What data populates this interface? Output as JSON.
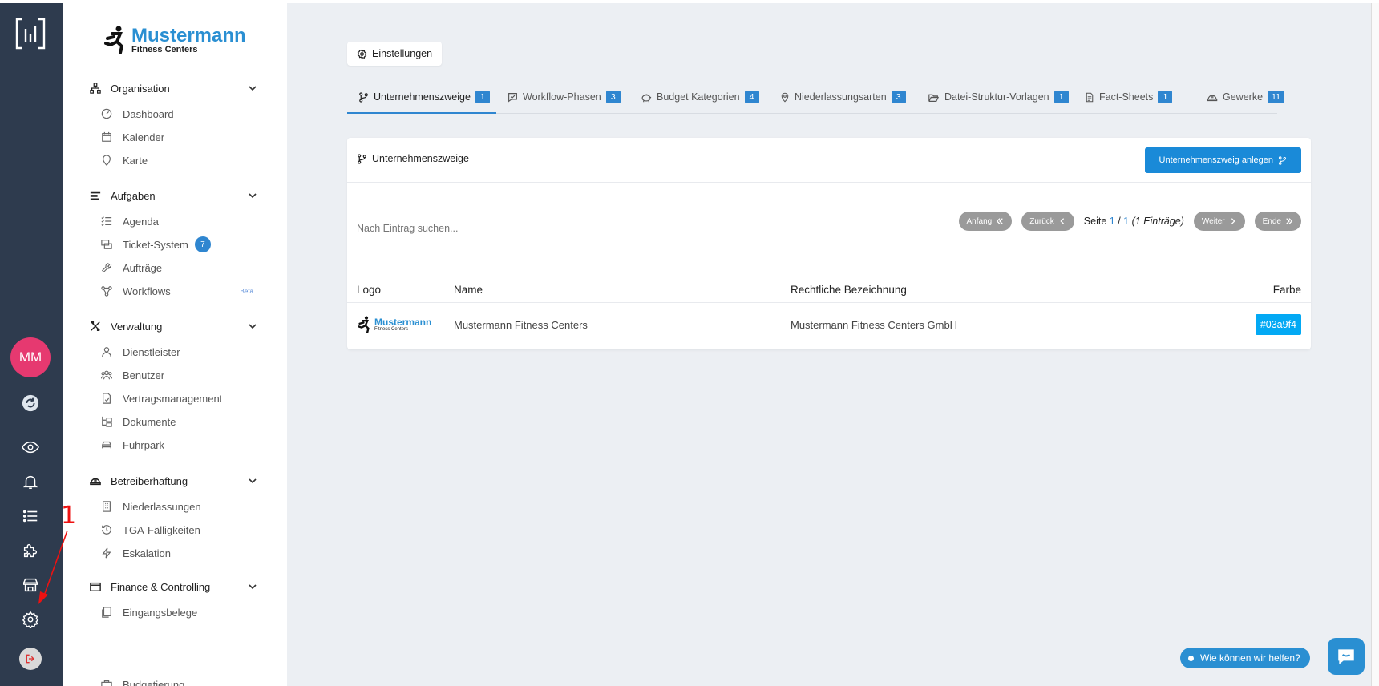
{
  "rail": {
    "avatar_initials": "MM",
    "icons": [
      "grid-logo-icon",
      "sync-icon",
      "eye-icon",
      "bell-icon",
      "list-icon",
      "puzzle-icon",
      "store-icon",
      "gear-icon",
      "logout-icon"
    ]
  },
  "sidebar": {
    "brand": {
      "name": "Mustermann",
      "sub": "Fitness Centers"
    },
    "sections": [
      {
        "label": "Organisation",
        "items": [
          {
            "label": "Dashboard"
          },
          {
            "label": "Kalender"
          },
          {
            "label": "Karte"
          }
        ]
      },
      {
        "label": "Aufgaben",
        "items": [
          {
            "label": "Agenda"
          },
          {
            "label": "Ticket-System",
            "badge": "7"
          },
          {
            "label": "Aufträge"
          },
          {
            "label": "Workflows",
            "tag": "Beta"
          }
        ]
      },
      {
        "label": "Verwaltung",
        "items": [
          {
            "label": "Dienstleister"
          },
          {
            "label": "Benutzer"
          },
          {
            "label": "Vertragsmanagement"
          },
          {
            "label": "Dokumente"
          },
          {
            "label": "Fuhrpark"
          }
        ]
      },
      {
        "label": "Betreiberhaftung",
        "items": [
          {
            "label": "Niederlassungen"
          },
          {
            "label": "TGA-Fälligkeiten"
          },
          {
            "label": "Eskalation"
          }
        ]
      },
      {
        "label": "Finance & Controlling",
        "items": [
          {
            "label": "Eingangsbelege"
          },
          {
            "label": "Budgetierung"
          }
        ]
      }
    ]
  },
  "main": {
    "settings_label": "Einstellungen",
    "tabs": [
      {
        "label": "Unternehmenszweige",
        "count": "1"
      },
      {
        "label": "Workflow-Phasen",
        "count": "3"
      },
      {
        "label": "Budget Kategorien",
        "count": "4"
      },
      {
        "label": "Niederlassungsarten",
        "count": "3"
      },
      {
        "label": "Datei-Struktur-Vorlagen",
        "count": "1"
      },
      {
        "label": "Fact-Sheets",
        "count": "1"
      },
      {
        "label": "Gewerke",
        "count": "11"
      }
    ],
    "card": {
      "title": "Unternehmenszweige",
      "create_label": "Unternehmenszweig anlegen",
      "search_placeholder": "Nach Eintrag suchen...",
      "pager": {
        "first": "Anfang",
        "prev": "Zurück",
        "page_word": "Seite",
        "page": "1",
        "sep": "/",
        "total": "1",
        "entries": "(1 Einträge)",
        "next": "Weiter",
        "last": "Ende"
      },
      "columns": [
        "Logo",
        "Name",
        "Rechtliche Bezeichnung",
        "Farbe"
      ],
      "rows": [
        {
          "logo_name": "Mustermann",
          "logo_sub": "Fitness Centers",
          "name": "Mustermann Fitness Centers",
          "legal": "Mustermann Fitness Centers GmbH",
          "color": "#03a9f4"
        }
      ]
    }
  },
  "help": {
    "label": "Wie können wir helfen?"
  },
  "annotation": {
    "number": "1"
  },
  "colors": {
    "rail": "#2e3b4e",
    "accent": "#2f86d0",
    "avatar": "#e63970",
    "chip": "#03a9f4"
  }
}
